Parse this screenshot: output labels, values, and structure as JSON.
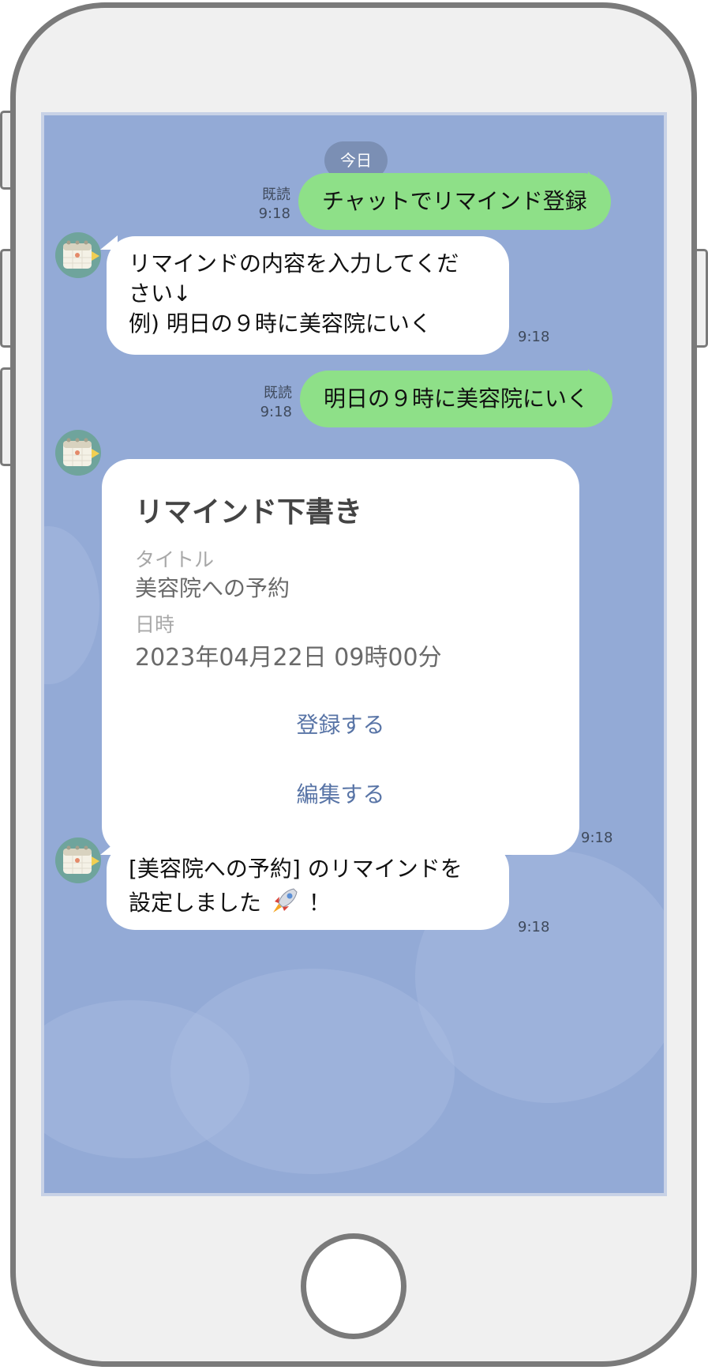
{
  "chat": {
    "date_label": "今日",
    "messages": [
      {
        "from": "user",
        "read": "既読",
        "time": "9:18",
        "text": "チャットでリマインド登録"
      },
      {
        "from": "bot",
        "time": "9:18",
        "lines": [
          "リマインドの内容を入力してくだ",
          "さい↓",
          "例) 明日の９時に美容院にいく"
        ]
      },
      {
        "from": "user",
        "read": "既読",
        "time": "9:18",
        "text": "明日の９時に美容院にいく"
      },
      {
        "from": "bot",
        "time": "9:18",
        "card": {
          "title": "リマインド下書き",
          "title_label": "タイトル",
          "title_value": "美容院への予約",
          "datetime_label": "日時",
          "datetime_value": "2023年04月22日 09時00分",
          "register_label": "登録する",
          "edit_label": "編集する"
        }
      },
      {
        "from": "bot",
        "time": "9:18",
        "lines": [
          "[美容院への予約] のリマインドを",
          "設定しました"
        ],
        "suffix": "！",
        "emoji": "rocket-icon"
      }
    ]
  },
  "colors": {
    "chat_background": "#93aad6",
    "user_bubble": "#8ee088",
    "bot_bubble": "#ffffff",
    "action_link": "#5874a6"
  }
}
